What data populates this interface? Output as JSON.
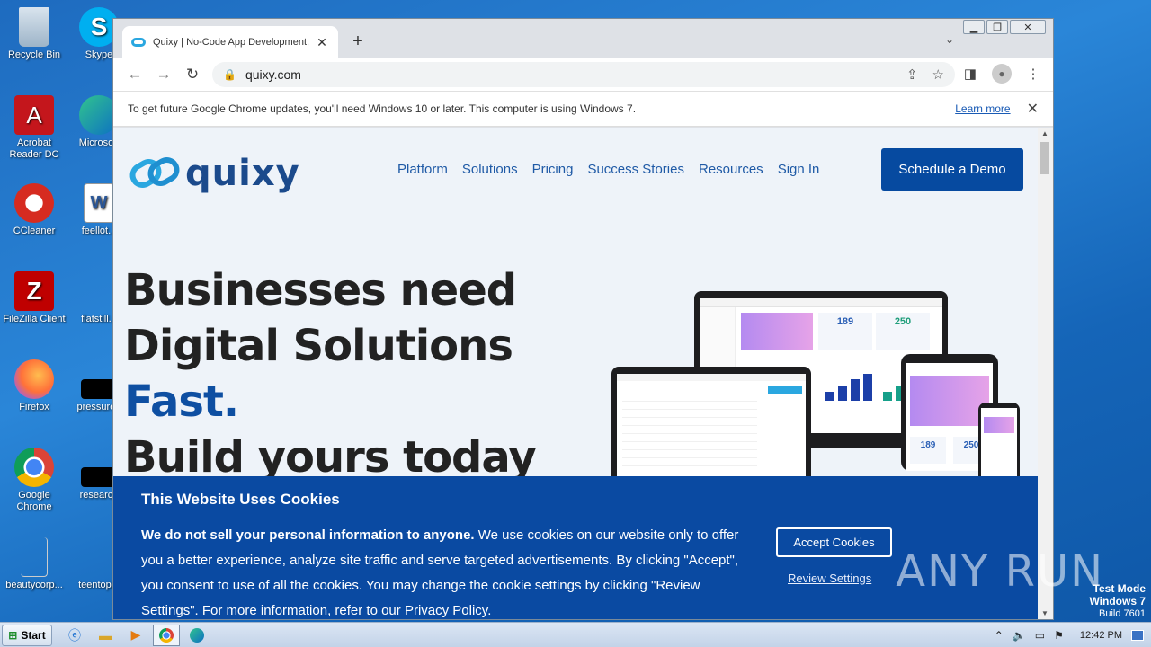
{
  "desktop": {
    "icons": [
      {
        "label": "Recycle Bin"
      },
      {
        "label": "Skype"
      },
      {
        "label": "Acrobat Reader DC"
      },
      {
        "label": "Microsoft"
      },
      {
        "label": "CCleaner"
      },
      {
        "label": "feellot..."
      },
      {
        "label": "FileZilla Client"
      },
      {
        "label": "flatstill.p"
      },
      {
        "label": "Firefox"
      },
      {
        "label": "pressureb"
      },
      {
        "label": "Google Chrome"
      },
      {
        "label": "research"
      },
      {
        "label": "beautycorp..."
      },
      {
        "label": "teentop..."
      }
    ]
  },
  "browser": {
    "tab_title": "Quixy | No-Code App Development,",
    "tab_close": "✕",
    "new_tab": "+",
    "url": "quixy.com",
    "infobar_message": "To get future Google Chrome updates, you'll need Windows 10 or later. This computer is using Windows 7.",
    "infobar_link": "Learn more",
    "infobar_close": "✕"
  },
  "page": {
    "logo_text": "quixy",
    "nav": [
      "Platform",
      "Solutions",
      "Pricing",
      "Success Stories",
      "Resources",
      "Sign In"
    ],
    "cta": "Schedule a Demo",
    "hero": {
      "line1": "Businesses need",
      "line2": "Digital Solutions",
      "line3": "Fast.",
      "line4": "Build yours today"
    },
    "mockup": {
      "stat1": "189",
      "stat2": "250",
      "tablet_stat1": "189",
      "tablet_stat2": "250"
    }
  },
  "cookie": {
    "heading": "This Website Uses Cookies",
    "body_bold": "We do not sell your personal information to anyone.",
    "body_text": " We use cookies on our website only to offer you a better experience, analyze site traffic and serve targeted advertisements. By clicking \"Accept\", you consent to use of all the cookies. You may change the cookie settings by clicking \"Review Settings\". For more information, refer to our ",
    "privacy_link": "Privacy Policy",
    "body_end": ".",
    "accept": "Accept Cookies",
    "review": "Review Settings"
  },
  "watermark": {
    "brand": "ANY RUN",
    "line1": "Test Mode",
    "line2": "Windows 7",
    "line3": "Build 7601"
  },
  "taskbar": {
    "start": "Start",
    "clock": "12:42 PM"
  },
  "colors": {
    "brand_blue": "#0a4aa2",
    "nav_blue": "#1f5aa6",
    "logo_cyan": "#2aa7e0"
  }
}
